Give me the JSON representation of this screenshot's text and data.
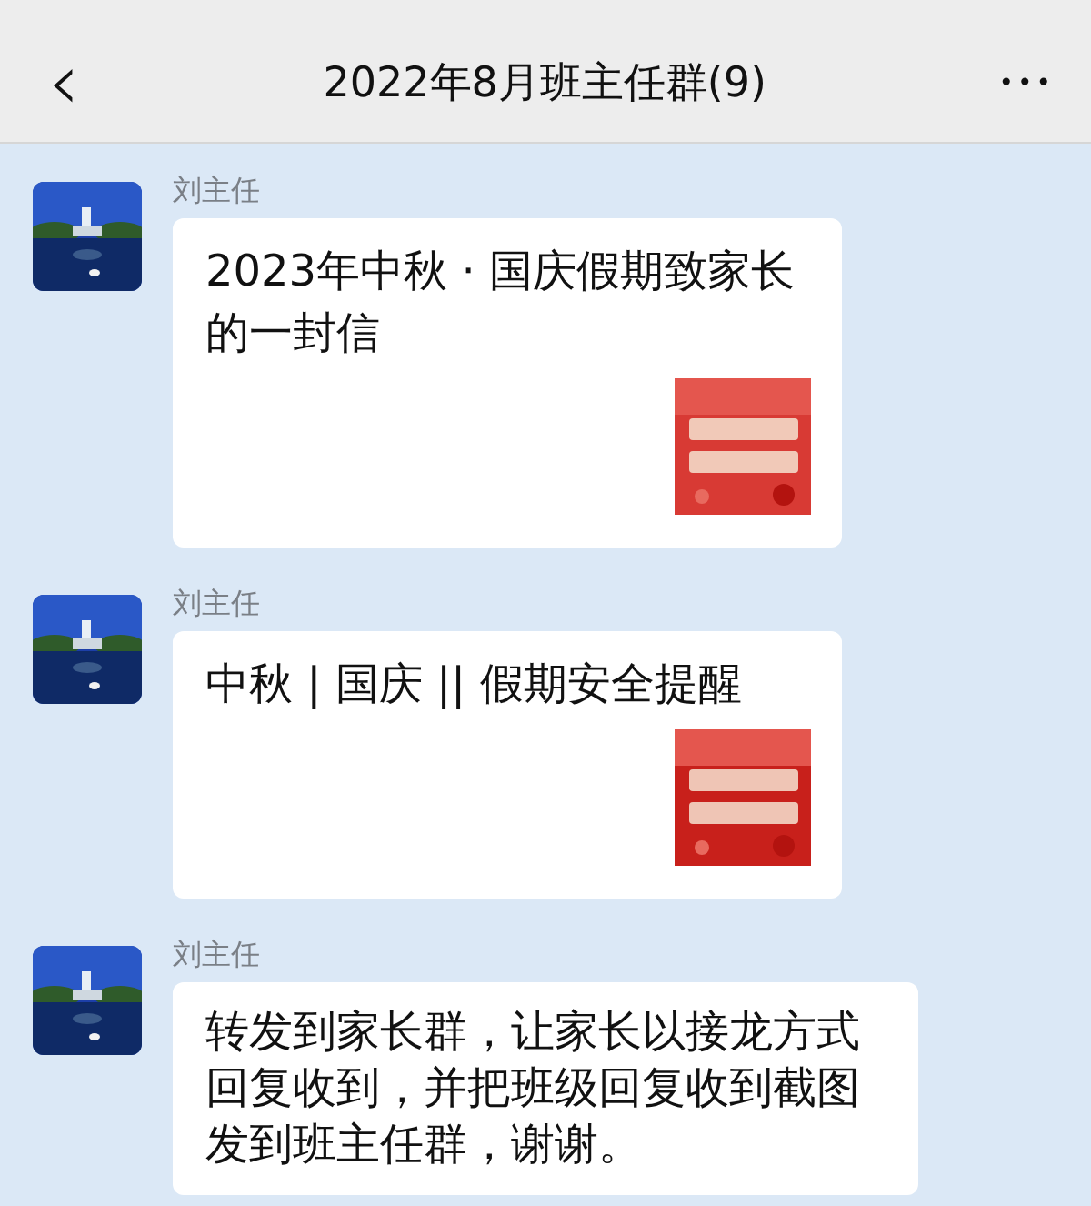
{
  "header": {
    "back": "‹",
    "title": "2022年8月班主任群(9)",
    "more": "•••"
  },
  "messages": [
    {
      "sender": "刘主任",
      "kind": "link_card",
      "text": "2023年中秋 · 国庆假期致家长的一封信"
    },
    {
      "sender": "刘主任",
      "kind": "link_card",
      "text": "中秋 | 国庆 || 假期安全提醒"
    },
    {
      "sender": "刘主任",
      "kind": "text",
      "text": "转发到家长群，让家长以接龙方式回复收到，并把班级回复收到截图发到班主任群，谢谢。"
    }
  ]
}
